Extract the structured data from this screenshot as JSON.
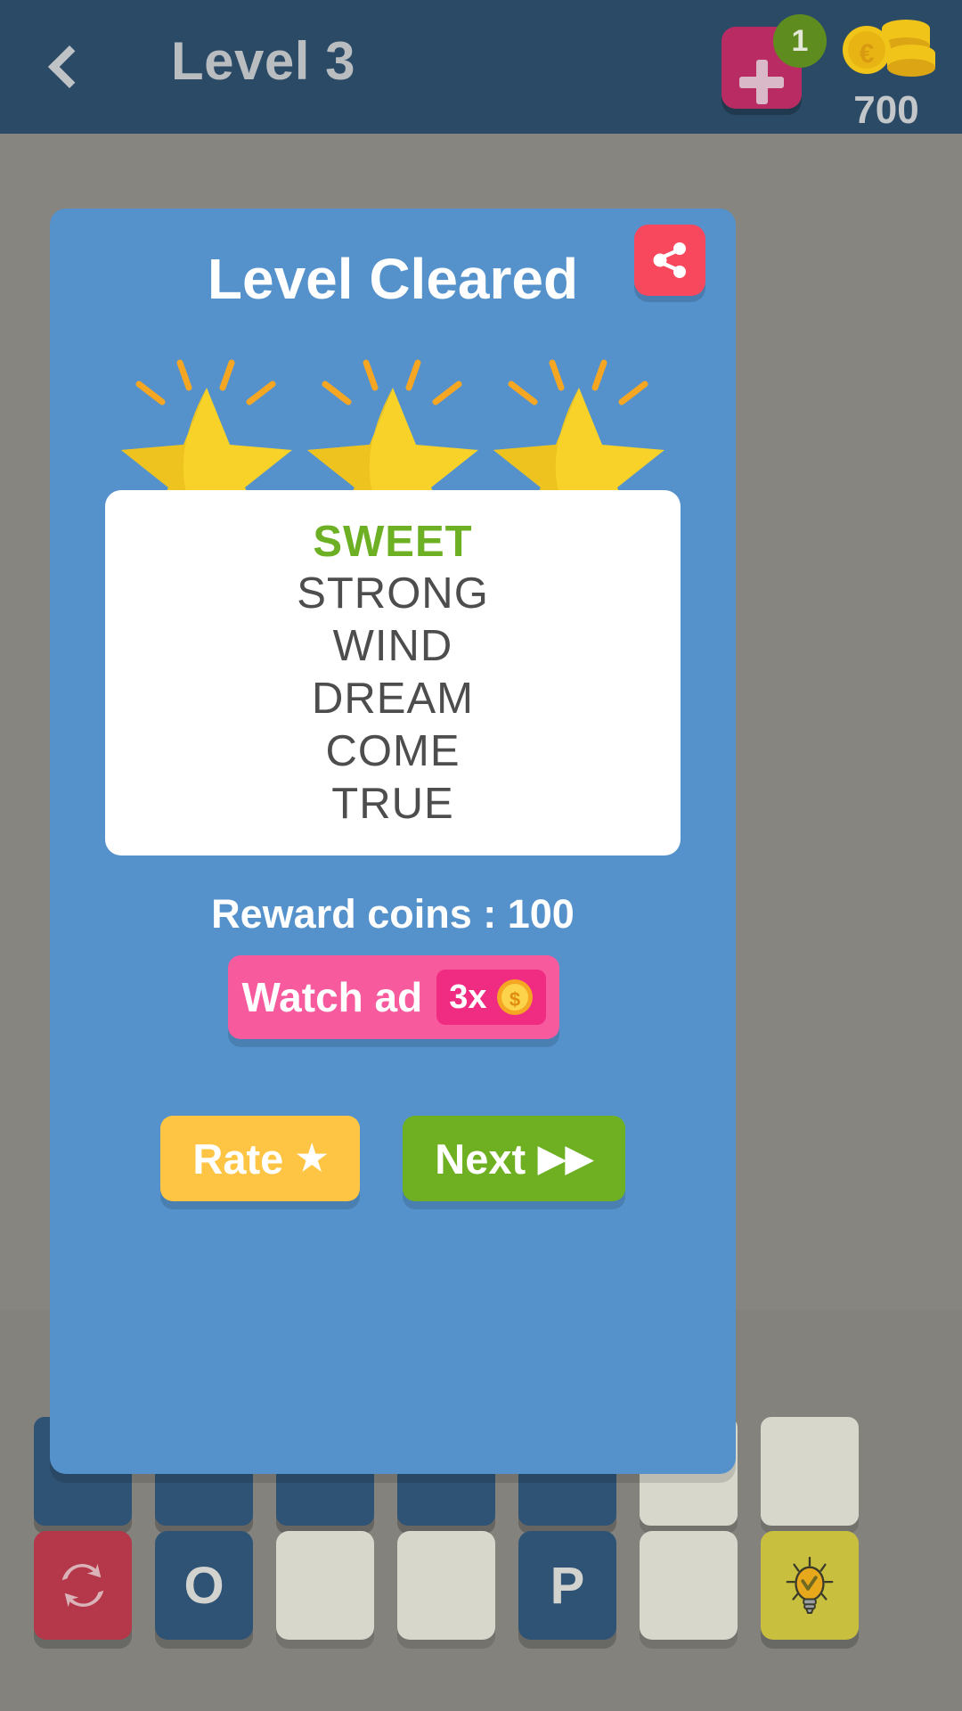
{
  "header": {
    "back_icon": "chevron-left-icon",
    "title": "Level 3",
    "add_button_icon": "plus-icon",
    "add_badge_count": "1",
    "coins_icon": "coin-stack-icon",
    "coins_amount": "700"
  },
  "modal": {
    "title": "Level Cleared",
    "share_icon": "share-icon",
    "stars_count": 3,
    "words": [
      {
        "text": "SWEET",
        "found": true
      },
      {
        "text": "STRONG",
        "found": false
      },
      {
        "text": "WIND",
        "found": false
      },
      {
        "text": "DREAM",
        "found": false
      },
      {
        "text": "COME",
        "found": false
      },
      {
        "text": "TRUE",
        "found": false
      }
    ],
    "reward_label": "Reward coins : 100",
    "watch_ad": {
      "label": "Watch ad",
      "multiplier": "3x",
      "coin_icon": "dollar-coin-icon"
    },
    "rate_button": {
      "label": "Rate",
      "glyph": "★"
    },
    "next_button": {
      "label": "Next",
      "glyph": "▶▶"
    }
  },
  "keyboard": {
    "keys": [
      {
        "type": "shuffle",
        "label": "",
        "icon": "shuffle-icon"
      },
      {
        "type": "letter",
        "label": "O"
      },
      {
        "type": "blank",
        "label": ""
      },
      {
        "type": "blank",
        "label": ""
      },
      {
        "type": "letter",
        "label": "P"
      },
      {
        "type": "blank",
        "label": ""
      },
      {
        "type": "hint",
        "label": "",
        "icon": "lightbulb-icon"
      }
    ]
  },
  "colors": {
    "header_bg": "#2b4a66",
    "modal_bg": "#5592cc",
    "found_word": "#6eb023",
    "word_text": "#4d4d4d",
    "share_btn": "#f8485e",
    "watch_ad": "#f75b9e",
    "rate_btn": "#fdc543",
    "next_btn": "#6fb023",
    "overlay_dim": "#7f7f7a"
  }
}
